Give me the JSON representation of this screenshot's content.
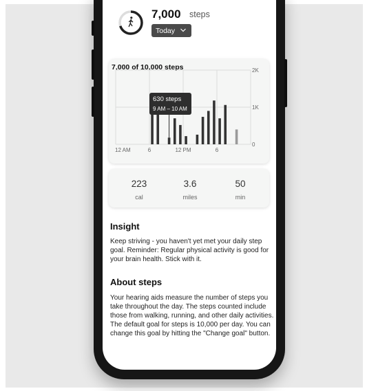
{
  "header": {
    "steps_value": "7,000",
    "steps_unit": "steps",
    "range_label": "Today"
  },
  "chart_card": {
    "title": "7,000 of 10,000 steps",
    "tooltip": {
      "steps": "630 steps",
      "time": "9 AM – 10 AM"
    }
  },
  "chart_data": {
    "type": "bar",
    "title": "7,000 of 10,000 steps",
    "x_tick_labels": [
      "12 AM",
      "6",
      "12 PM",
      "6"
    ],
    "y_tick_labels": [
      "2K",
      "1K",
      "0"
    ],
    "ylim": [
      0,
      2000
    ],
    "grid": true,
    "hours": [
      6,
      7,
      8,
      9,
      10,
      11,
      12,
      13,
      14,
      15,
      16,
      17,
      18,
      19,
      21
    ],
    "values": [
      820,
      1000,
      0,
      180,
      700,
      520,
      220,
      0,
      260,
      740,
      900,
      1180,
      700,
      1060,
      400
    ],
    "highlighted_hour": 9,
    "colors": {
      "bar": "#333333",
      "bar_inactive": "#9a9a9a",
      "grid": "#dcdcdc"
    }
  },
  "stats": [
    {
      "value": "223",
      "label": "cal"
    },
    {
      "value": "3.6",
      "label": "miles"
    },
    {
      "value": "50",
      "label": "min"
    }
  ],
  "insight": {
    "heading": "Insight",
    "body": "Keep striving - you haven't yet met your daily step goal. Reminder: Regular physical activity is good for your brain health. Stick with it."
  },
  "about": {
    "heading": "About steps",
    "body": "Your hearing aids measure the number of steps you take throughout the day. The steps counted include those from walking, running, and other daily activities. The default goal for steps is 10,000 per day. You can change this goal by hitting the \"Change goal\" button."
  },
  "icons": [
    "walking-person-icon",
    "chevron-down-icon"
  ]
}
